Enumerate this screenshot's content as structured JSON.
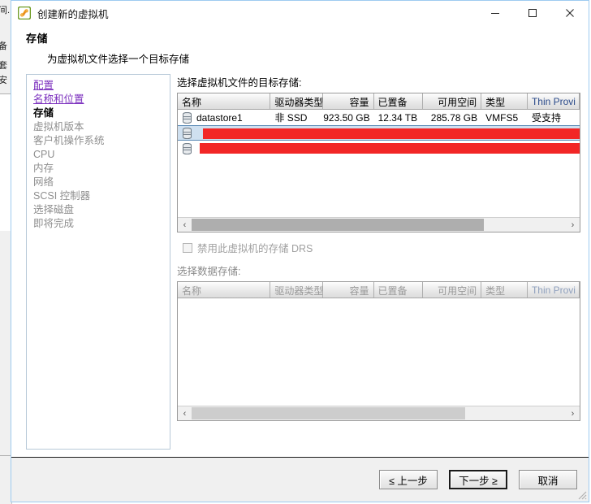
{
  "window": {
    "title": "创建新的虚拟机",
    "app_icon": "vm-wizard-icon",
    "minimize_label": "最小化",
    "maximize_label": "最大化",
    "close_label": "关闭"
  },
  "header": {
    "title": "存储",
    "subtitle": "为虚拟机文件选择一个目标存储"
  },
  "sidebar": {
    "items": [
      {
        "label": "配置",
        "state": "link"
      },
      {
        "label": "名称和位置",
        "state": "link"
      },
      {
        "label": "存储",
        "state": "current"
      },
      {
        "label": "虚拟机版本",
        "state": "dim"
      },
      {
        "label": "客户机操作系统",
        "state": "dim"
      },
      {
        "label": "CPU",
        "state": "dim"
      },
      {
        "label": "内存",
        "state": "dim"
      },
      {
        "label": "网络",
        "state": "dim"
      },
      {
        "label": "SCSI 控制器",
        "state": "dim"
      },
      {
        "label": "选择磁盘",
        "state": "dim"
      },
      {
        "label": "即将完成",
        "state": "dim"
      }
    ]
  },
  "main": {
    "upper_label": "选择虚拟机文件的目标存储:",
    "columns": [
      "名称",
      "驱动器类型",
      "容量",
      "已置备",
      "可用空间",
      "类型",
      "Thin Provi"
    ],
    "rows": [
      {
        "icon": "datastore-icon",
        "name": "datastore1",
        "drive_type": "非 SSD",
        "capacity": "923.50 GB",
        "provisioned": "12.34 TB",
        "free": "285.78 GB",
        "type": "VMFS5",
        "thin_provisioning": "受支持",
        "redacted": false,
        "selected": false
      },
      {
        "icon": "datastore-icon",
        "name": "",
        "drive_type": "",
        "capacity": "",
        "provisioned": "",
        "free": "",
        "type": "",
        "thin_provisioning": "",
        "redacted": true,
        "selected": true
      },
      {
        "icon": "datastore-icon",
        "name": "",
        "drive_type": "",
        "capacity": "",
        "provisioned": "",
        "free": "",
        "type": "",
        "thin_provisioning": "",
        "redacted": true,
        "selected": false
      }
    ],
    "upper_scroll": {
      "thumb_percent": 78,
      "left_arrow": "‹",
      "right_arrow": "›",
      "enabled": true
    },
    "drs_checkbox": {
      "label": "禁用此虚拟机的存储 DRS",
      "checked": false,
      "disabled": true
    },
    "lower_label": "选择数据存储:",
    "lower_columns": [
      "名称",
      "驱动器类型",
      "容量",
      "已置备",
      "可用空间",
      "类型",
      "Thin Provi"
    ],
    "lower_rows": [],
    "lower_scroll": {
      "thumb_percent": 73,
      "left_arrow": "‹",
      "right_arrow": "›",
      "enabled": false
    }
  },
  "footer": {
    "back_label": "≤ 上一步",
    "next_label": "下一步 ≥",
    "cancel_label": "取消"
  },
  "background_window": {
    "fragments": [
      "间.",
      "备",
      "套",
      "安"
    ]
  },
  "colors": {
    "redaction": "#f22626",
    "selection": "#cfe0f0",
    "link": "#7b2fbe",
    "window_border": "#9ecbf0",
    "thin_header": "#2a4a8a"
  }
}
